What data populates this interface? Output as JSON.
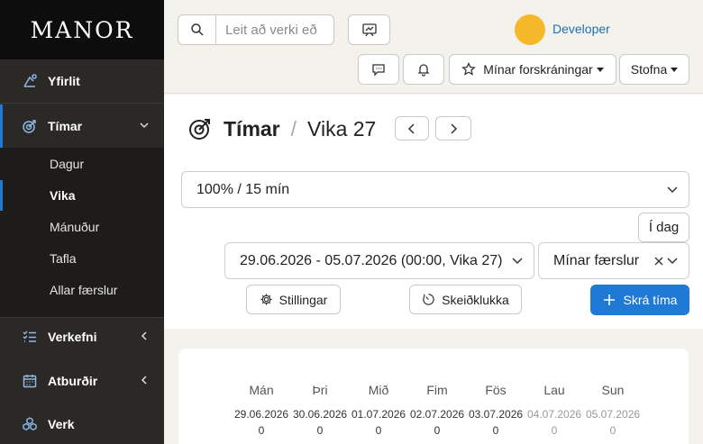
{
  "app": {
    "logo": "MANOR"
  },
  "sidebar": {
    "items": [
      {
        "label": "Yfirlit",
        "icon": "dashboard-icon"
      },
      {
        "label": "Tímar",
        "icon": "target-clock-icon"
      },
      {
        "label": "Verkefni",
        "icon": "task-list-icon"
      },
      {
        "label": "Atburðir",
        "icon": "calendar-icon"
      },
      {
        "label": "Verk",
        "icon": "cubes-icon"
      }
    ],
    "subitems": [
      "Dagur",
      "Vika",
      "Mánuður",
      "Tafla",
      "Allar færslur"
    ],
    "active_item": "Tímar",
    "active_subitem": "Vika"
  },
  "header": {
    "search_placeholder": "Leit að verki eð",
    "user_name": "Developer",
    "favorites_label": "Mínar forskráningar",
    "create_label": "Stofna"
  },
  "main": {
    "title": "Tímar",
    "separator": "/",
    "week_label": "Vika 27",
    "rounding_select": "100% / 15 mín",
    "today_button": "Í dag",
    "date_range": "29.06.2026 - 05.07.2026 (00:00, Vika 27)",
    "filter_select": "Mínar færslur",
    "settings_button": "Stillingar",
    "stopwatch_button": "Skeiðklukka",
    "register_button": "Skrá tíma"
  },
  "week": {
    "days": [
      {
        "name": "Mán",
        "date": "29.06.2026",
        "count": "0",
        "weekend": false
      },
      {
        "name": "Þri",
        "date": "30.06.2026",
        "count": "0",
        "weekend": false
      },
      {
        "name": "Mið",
        "date": "01.07.2026",
        "count": "0",
        "weekend": false
      },
      {
        "name": "Fim",
        "date": "02.07.2026",
        "count": "0",
        "weekend": false
      },
      {
        "name": "Fös",
        "date": "03.07.2026",
        "count": "0",
        "weekend": false
      },
      {
        "name": "Lau",
        "date": "04.07.2026",
        "count": "0",
        "weekend": true
      },
      {
        "name": "Sun",
        "date": "05.07.2026",
        "count": "0",
        "weekend": true
      }
    ]
  },
  "colors": {
    "accent": "#1f7ad6",
    "sidebar_bg": "#2b2926",
    "avatar": "#f5b82a",
    "user_link": "#1f6fb5"
  }
}
